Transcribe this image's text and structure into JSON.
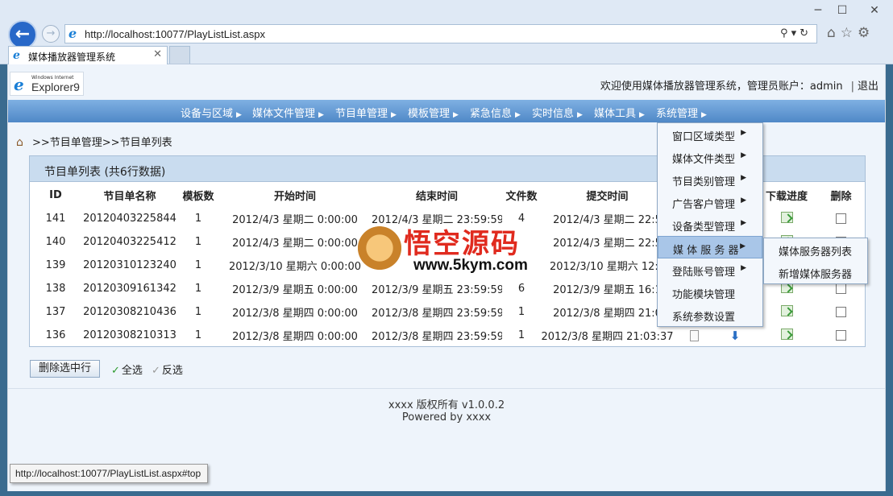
{
  "browser": {
    "address": "http://localhost:10077/PlayListList.aspx",
    "tab_title": "媒体播放器管理系统",
    "status_url": "http://localhost:10077/PlayListList.aspx#top",
    "window_controls": {
      "minimize": "─",
      "maximize": "☐",
      "close": "✕"
    }
  },
  "header": {
    "logo_small": "Windows Internet",
    "logo_big": "Explorer9",
    "welcome": "欢迎使用媒体播放器管理系统，管理员账户：admin",
    "logout": "退出"
  },
  "nav": {
    "items": [
      "设备与区域",
      "媒体文件管理",
      "节目单管理",
      "模板管理",
      "紧急信息",
      "实时信息",
      "媒体工具",
      "系统管理"
    ]
  },
  "breadcrumb": ">>节目单管理>>节目单列表",
  "grid": {
    "title": "节目单列表 (共6行数据)",
    "columns": [
      "ID",
      "节目单名称",
      "模板数",
      "开始时间",
      "结束时间",
      "文件数",
      "提交时间",
      "",
      "",
      "下载进度",
      "删除"
    ],
    "rows": [
      {
        "id": "141",
        "name": "20120403225844",
        "templates": "1",
        "start": "2012/4/3 星期二 0:00:00",
        "end": "2012/4/3 星期二 23:59:59",
        "files": "4",
        "submitted": "2012/4/3 星期二 22:5"
      },
      {
        "id": "140",
        "name": "20120403225412",
        "templates": "1",
        "start": "2012/4/3 星期二 0:00:00",
        "end": "",
        "files": "",
        "submitted": "2012/4/3 星期二 22:5"
      },
      {
        "id": "139",
        "name": "20120310123240",
        "templates": "1",
        "start": "2012/3/10 星期六 0:00:00",
        "end": "",
        "files": "",
        "submitted": "2012/3/10 星期六 12:3"
      },
      {
        "id": "138",
        "name": "20120309161342",
        "templates": "1",
        "start": "2012/3/9 星期五 0:00:00",
        "end": "2012/3/9 星期五 23:59:59",
        "files": "6",
        "submitted": "2012/3/9 星期五 16:1"
      },
      {
        "id": "137",
        "name": "20120308210436",
        "templates": "1",
        "start": "2012/3/8 星期四 0:00:00",
        "end": "2012/3/8 星期四 23:59:59",
        "files": "1",
        "submitted": "2012/3/8 星期四 21:0"
      },
      {
        "id": "136",
        "name": "20120308210313",
        "templates": "1",
        "start": "2012/3/8 星期四 0:00:00",
        "end": "2012/3/8 星期四 23:59:59",
        "files": "1",
        "submitted": "2012/3/8 星期四 21:03:37"
      }
    ]
  },
  "actions": {
    "delete_selected": "删除选中行",
    "select_all": "全选",
    "invert": "反选"
  },
  "footer": {
    "copyright": "xxxx 版权所有 v1.0.0.2",
    "powered": "Powered by xxxx"
  },
  "menu": {
    "items": [
      "窗口区域类型",
      "媒体文件类型",
      "节目类别管理",
      "广告客户管理",
      "设备类型管理",
      "媒 体 服 务 器",
      "登陆账号管理",
      "功能模块管理",
      "系统参数设置"
    ],
    "active_index": 5,
    "submenu": [
      "媒体服务器列表",
      "新增媒体服务器"
    ]
  },
  "watermark": {
    "title": "悟空源码",
    "url": "www.5kym.com"
  }
}
